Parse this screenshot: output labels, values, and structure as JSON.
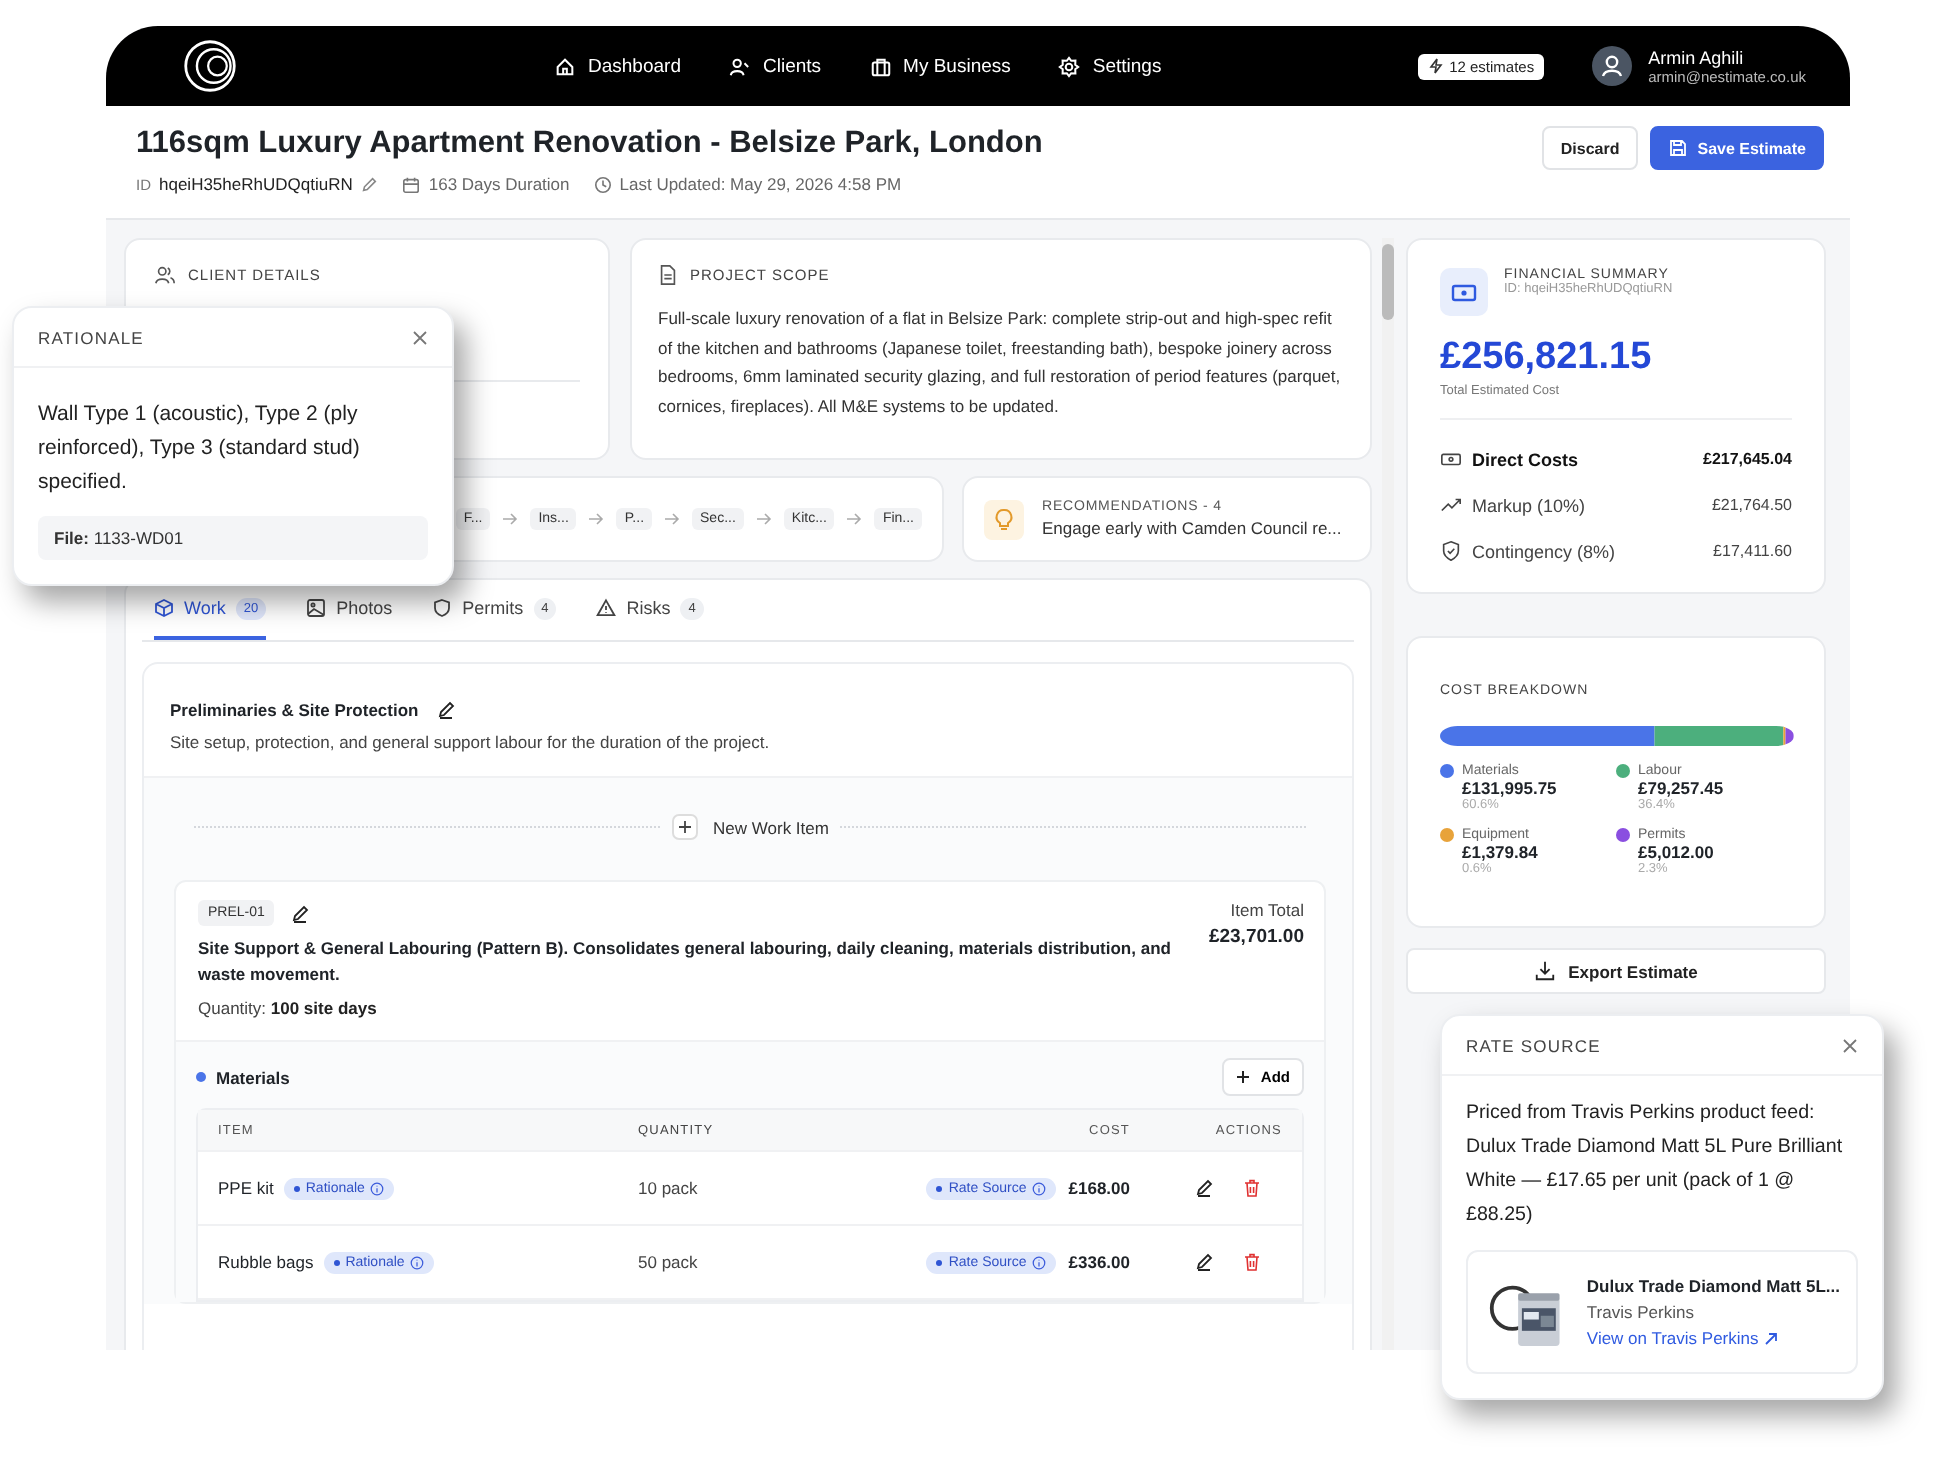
{
  "nav": {
    "items": [
      "Dashboard",
      "Clients",
      "My Business",
      "Settings"
    ],
    "estimates_badge": "12 estimates",
    "user": {
      "name": "Armin Aghili",
      "email": "armin@nestimate.co.uk"
    }
  },
  "header": {
    "title": "116sqm Luxury Apartment Renovation - Belsize Park, London",
    "id_label": "ID",
    "id": "hqeiH35heRhUDQqtiuRN",
    "duration": "163 Days Duration",
    "updated": "Last Updated: May 29, 2026 4:58 PM",
    "buttons": [
      {
        "label": "Discard",
        "kind": "secondary"
      },
      {
        "label": "Save Estimate",
        "kind": "primary"
      }
    ]
  },
  "client_details": {
    "title": "CLIENT DETAILS"
  },
  "project_scope": {
    "title": "PROJECT SCOPE",
    "text": "Full-scale luxury renovation of a flat in Belsize Park: complete strip-out and high-spec refit of the kitchen and bathrooms (Japanese toilet, freestanding bath), bespoke joinery across bedrooms, 6mm laminated security glazing, and full restoration of period features (parquet, cornices, fireplaces). All M&E systems to be updated."
  },
  "timeline": {
    "steps": [
      "F...",
      "Ins...",
      "P...",
      "Sec...",
      "Kitc...",
      "Fin..."
    ]
  },
  "recommendations": {
    "title": "RECOMMENDATIONS - 4",
    "text": "Engage early with Camden Council re..."
  },
  "tabs": [
    {
      "label": "Work",
      "count": "20",
      "selected": true
    },
    {
      "label": "Photos",
      "selected": false
    },
    {
      "label": "Permits",
      "count": "4",
      "selected": false
    },
    {
      "label": "Risks",
      "count": "4",
      "selected": false
    }
  ],
  "section": {
    "title": "Preliminaries & Site Protection",
    "description": "Site setup, protection, and general support labour for the duration of the project.",
    "new_item": "New Work Item",
    "work_item": {
      "code": "PREL-01",
      "title": "Site Support & General Labouring (Pattern B). Consolidates general labouring, daily cleaning, materials distribution, and waste movement.",
      "quantity_label": "Quantity:",
      "quantity": "100 site days",
      "total_label": "Item Total",
      "total": "£23,701.00",
      "materials": {
        "title": "Materials",
        "add": "Add",
        "columns": [
          "ITEM",
          "QUANTITY",
          "COST",
          "ACTIONS"
        ],
        "rows": [
          {
            "item": "PPE kit",
            "rationale": "Rationale",
            "quantity": "10 pack",
            "rate_source": "Rate Source",
            "cost": "£168.00"
          },
          {
            "item": "Rubble bags",
            "rationale": "Rationale",
            "quantity": "50 pack",
            "rate_source": "Rate Source",
            "cost": "£336.00"
          }
        ]
      }
    }
  },
  "financial_summary": {
    "title": "FINANCIAL SUMMARY",
    "id": "ID: hqeiH35heRhUDQqtiuRN",
    "total": "£256,821.15",
    "total_label": "Total Estimated Cost",
    "lines": [
      {
        "label": "Direct Costs",
        "value": "£217,645.04",
        "kind": "direct"
      },
      {
        "label": "Markup (10%)",
        "value": "£21,764.50",
        "kind": "markup"
      },
      {
        "label": "Contingency (8%)",
        "value": "£17,411.60",
        "kind": "contingency"
      }
    ]
  },
  "cost_breakdown": {
    "title": "COST BREAKDOWN",
    "categories": [
      {
        "name": "Materials",
        "value": "£131,995.75",
        "percent": "60.6%",
        "color": "#4a74e8",
        "level": 0.606
      },
      {
        "name": "Labour",
        "value": "£79,257.45",
        "percent": "36.4%",
        "color": "#4caf7d",
        "level": 0.364
      },
      {
        "name": "Equipment",
        "value": "£1,379.84",
        "percent": "0.6%",
        "color": "#e8a33a",
        "level": 0.006
      },
      {
        "name": "Permits",
        "value": "£5,012.00",
        "percent": "2.3%",
        "color": "#8a4fe0",
        "level": 0.023
      }
    ]
  },
  "export_button": "Export Estimate",
  "rationale_popover": {
    "title": "RATIONALE",
    "text": "Wall Type 1 (acoustic), Type 2 (ply reinforced), Type 3 (standard stud) specified.",
    "file_label": "File:",
    "file": "1133-WD01"
  },
  "rate_source_popover": {
    "title": "RATE SOURCE",
    "text": "Priced from Travis Perkins product feed: Dulux Trade Diamond Matt 5L Pure Brilliant White — £17.65 per unit (pack of 1 @ £88.25)",
    "product": {
      "name": "Dulux Trade Diamond Matt 5L...",
      "supplier": "Travis Perkins",
      "link": "View on Travis Perkins"
    }
  }
}
